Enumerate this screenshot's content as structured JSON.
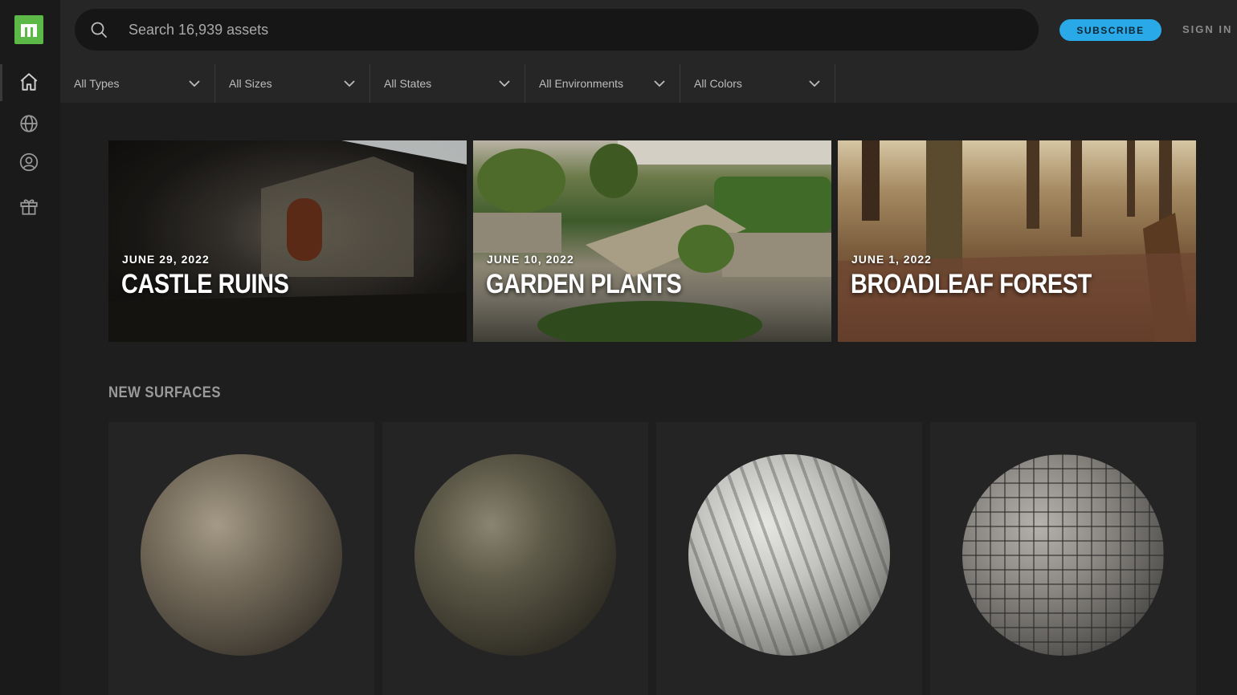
{
  "logo": {
    "letter": "m"
  },
  "search": {
    "placeholder": "Search 16,939 assets"
  },
  "header": {
    "subscribe_label": "SUBSCRIBE",
    "signin_label": "SIGN IN"
  },
  "filters": [
    {
      "label": "All Types"
    },
    {
      "label": "All Sizes"
    },
    {
      "label": "All States"
    },
    {
      "label": "All Environments"
    },
    {
      "label": "All Colors"
    }
  ],
  "featured": [
    {
      "date": "JUNE 29, 2022",
      "title": "CASTLE RUINS"
    },
    {
      "date": "JUNE 10, 2022",
      "title": "GARDEN PLANTS"
    },
    {
      "date": "JUNE 1, 2022",
      "title": "BROADLEAF FOREST"
    }
  ],
  "new_surfaces": {
    "title": "NEW SURFACES"
  },
  "colors": {
    "accent": "#29a9e8",
    "brand": "#5cb947",
    "background": "#1e1e1e"
  },
  "icons": [
    "search-icon",
    "home-icon",
    "globe-icon",
    "user-icon",
    "gift-icon",
    "chevron-down-icon"
  ]
}
